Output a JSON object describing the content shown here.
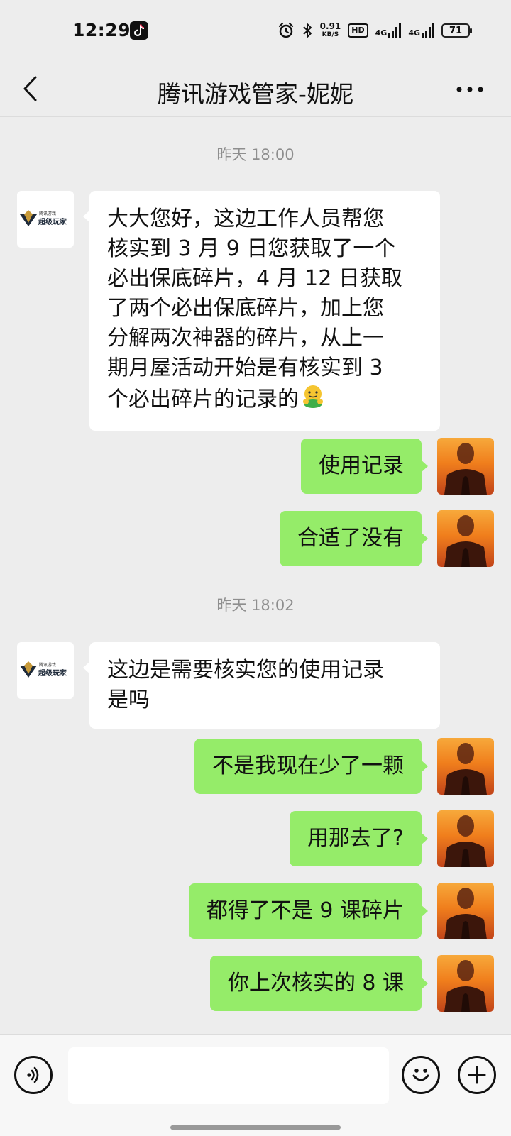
{
  "status_bar": {
    "time": "12:29",
    "speed_value": "0.91",
    "speed_unit": "KB/S",
    "hd_label": "HD",
    "net1": "4G",
    "net2": "4G",
    "battery": "71"
  },
  "header": {
    "title": "腾讯游戏管家-妮妮"
  },
  "chat": {
    "agent_logo_top": "腾讯游戏",
    "agent_logo_bottom": "超级玩家",
    "messages": [
      {
        "type": "timestamp",
        "text": "昨天 18:00"
      },
      {
        "type": "received",
        "lines": [
          "大大您好，这边工作人员帮您",
          "核实到 3 月 9 日您获取了一个",
          "必出保底碎片，4 月 12 日获取",
          "了两个必出保底碎片，加上您",
          "分解两次神器的碎片，从上一",
          "期月屋活动开始是有核实到 3",
          "个必出碎片的记录的"
        ]
      },
      {
        "type": "sent",
        "text": "使用记录"
      },
      {
        "type": "sent",
        "text": "合适了没有"
      },
      {
        "type": "timestamp",
        "text": "昨天 18:02"
      },
      {
        "type": "received",
        "lines": [
          "这边是需要核实您的使用记录",
          "是吗"
        ]
      },
      {
        "type": "sent",
        "text": "不是我现在少了一颗"
      },
      {
        "type": "sent",
        "text": "用那去了?"
      },
      {
        "type": "sent",
        "text": "都得了不是 9 课碎片"
      },
      {
        "type": "sent",
        "text": "你上次核实的 8 课"
      }
    ]
  },
  "input_bar": {
    "message_value": "",
    "message_placeholder": ""
  },
  "colors": {
    "background": "#ededed",
    "sent_bubble": "#95ec69",
    "received_bubble": "#ffffff",
    "timestamp_text": "#8e8e8e"
  },
  "icons": [
    "tiktok-icon",
    "alarm-icon",
    "bluetooth-icon",
    "back-arrow-icon",
    "more-icon",
    "voice-icon",
    "emoji-icon",
    "plus-icon",
    "hug-emoji-icon"
  ]
}
